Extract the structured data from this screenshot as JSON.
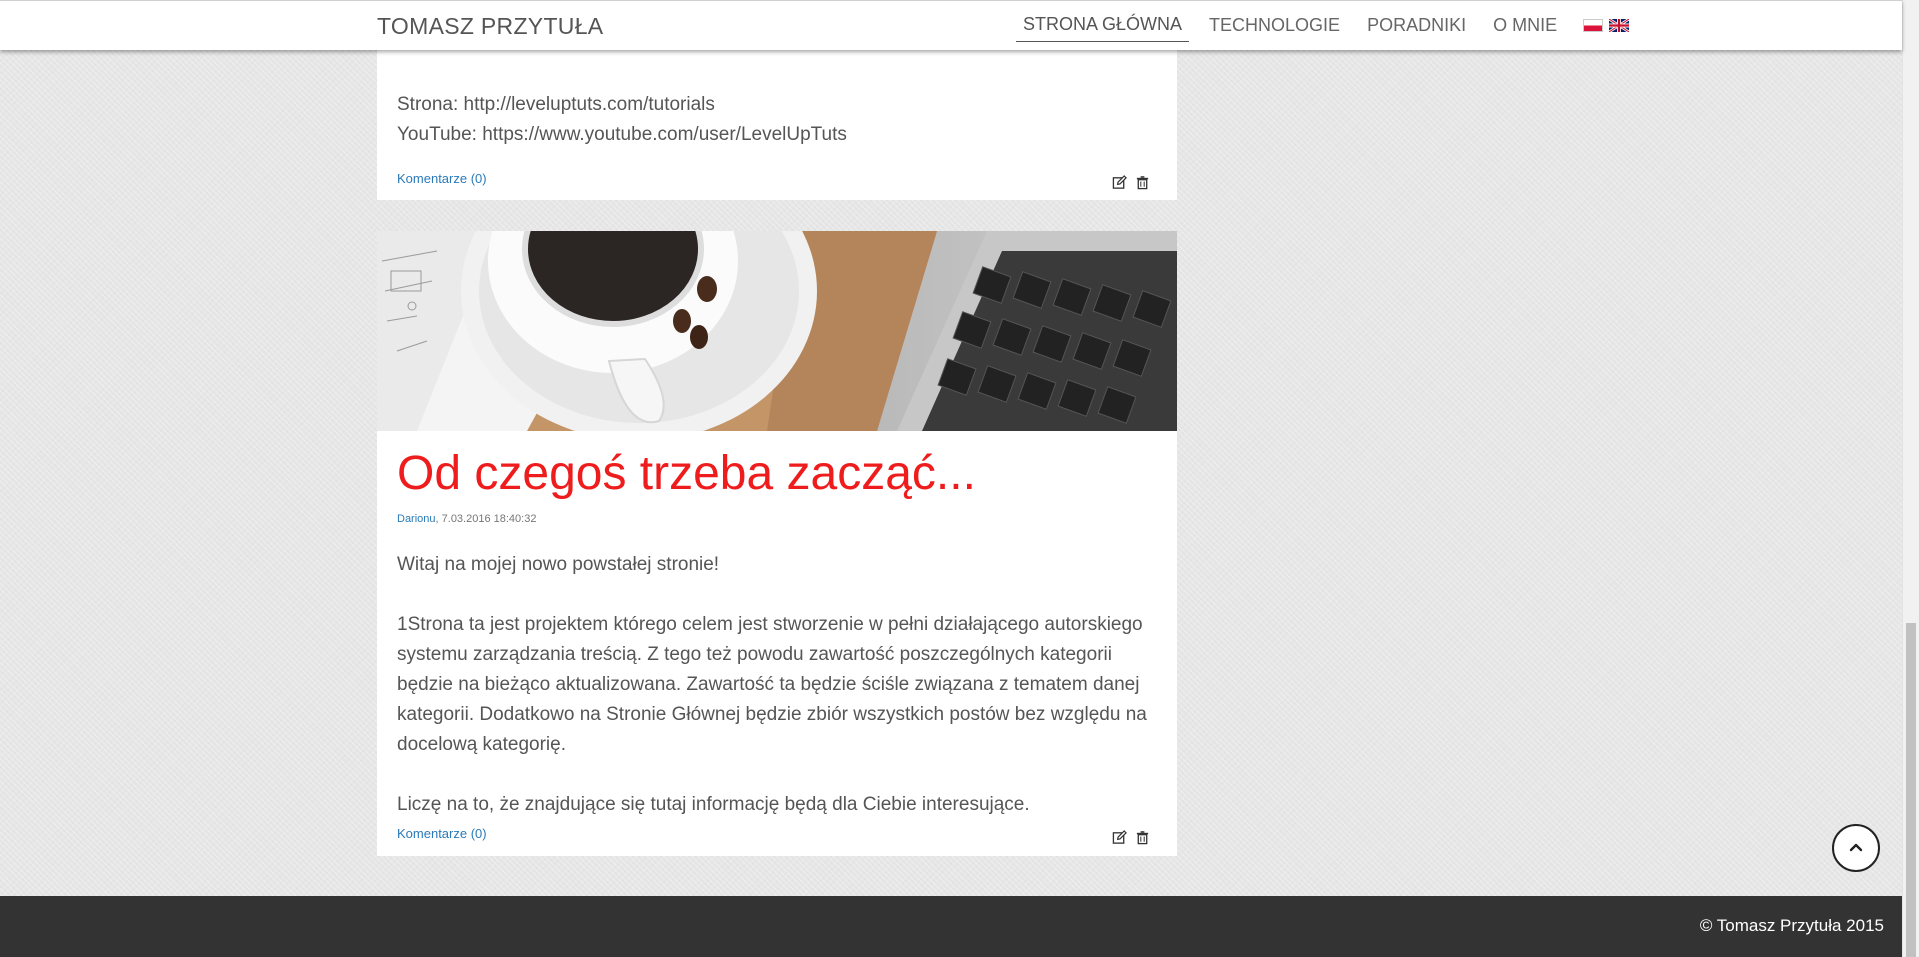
{
  "navbar": {
    "brand": "TOMASZ PRZYTUŁA",
    "items": [
      {
        "label": "STRONA GŁÓWNA",
        "active": true
      },
      {
        "label": "TECHNOLOGIE"
      },
      {
        "label": "PORADNIKI"
      },
      {
        "label": "O MNIE"
      }
    ],
    "languages": [
      "pl-flag-icon",
      "uk-flag-icon"
    ]
  },
  "posts": [
    {
      "body": [
        "Strona: http://leveluptuts.com/tutorials",
        "YouTube: https://www.youtube.com/user/LevelUpTuts"
      ],
      "comments_label": "Komentarze (0)"
    },
    {
      "image": "coffee-and-laptop-photo",
      "title": "Od czegoś trzeba zacząć...",
      "author": "Darionu",
      "date": ", 7.03.2016 18:40:32",
      "body": [
        "Witaj na mojej nowo powstałej stronie!",
        "1Strona ta jest projektem którego celem jest stworzenie w pełni działającego autorskiego systemu zarządzania treścią. Z tego też powodu zawartość poszczególnych kategorii będzie na bieżąco aktualizowana. Zawartość ta będzie ściśle związana z tematem danej kategorii. Dodatkowo na Stronie Głównej będzie zbiór wszystkich postów bez względu na docelową kategorię.",
        "Liczę na to, że znajdujące się tutaj informację będą dla Ciebie interesujące."
      ],
      "comments_label": "Komentarze (0)"
    }
  ],
  "footer": {
    "copyright": "© Tomasz Przytuła 2015"
  },
  "icons": {
    "edit": "edit-icon",
    "delete": "trash-icon",
    "scroll_top": "chevron-up-icon"
  },
  "colors": {
    "title": "#ee1c1c",
    "link": "#2a7ab8",
    "footer_bg": "#333333"
  }
}
